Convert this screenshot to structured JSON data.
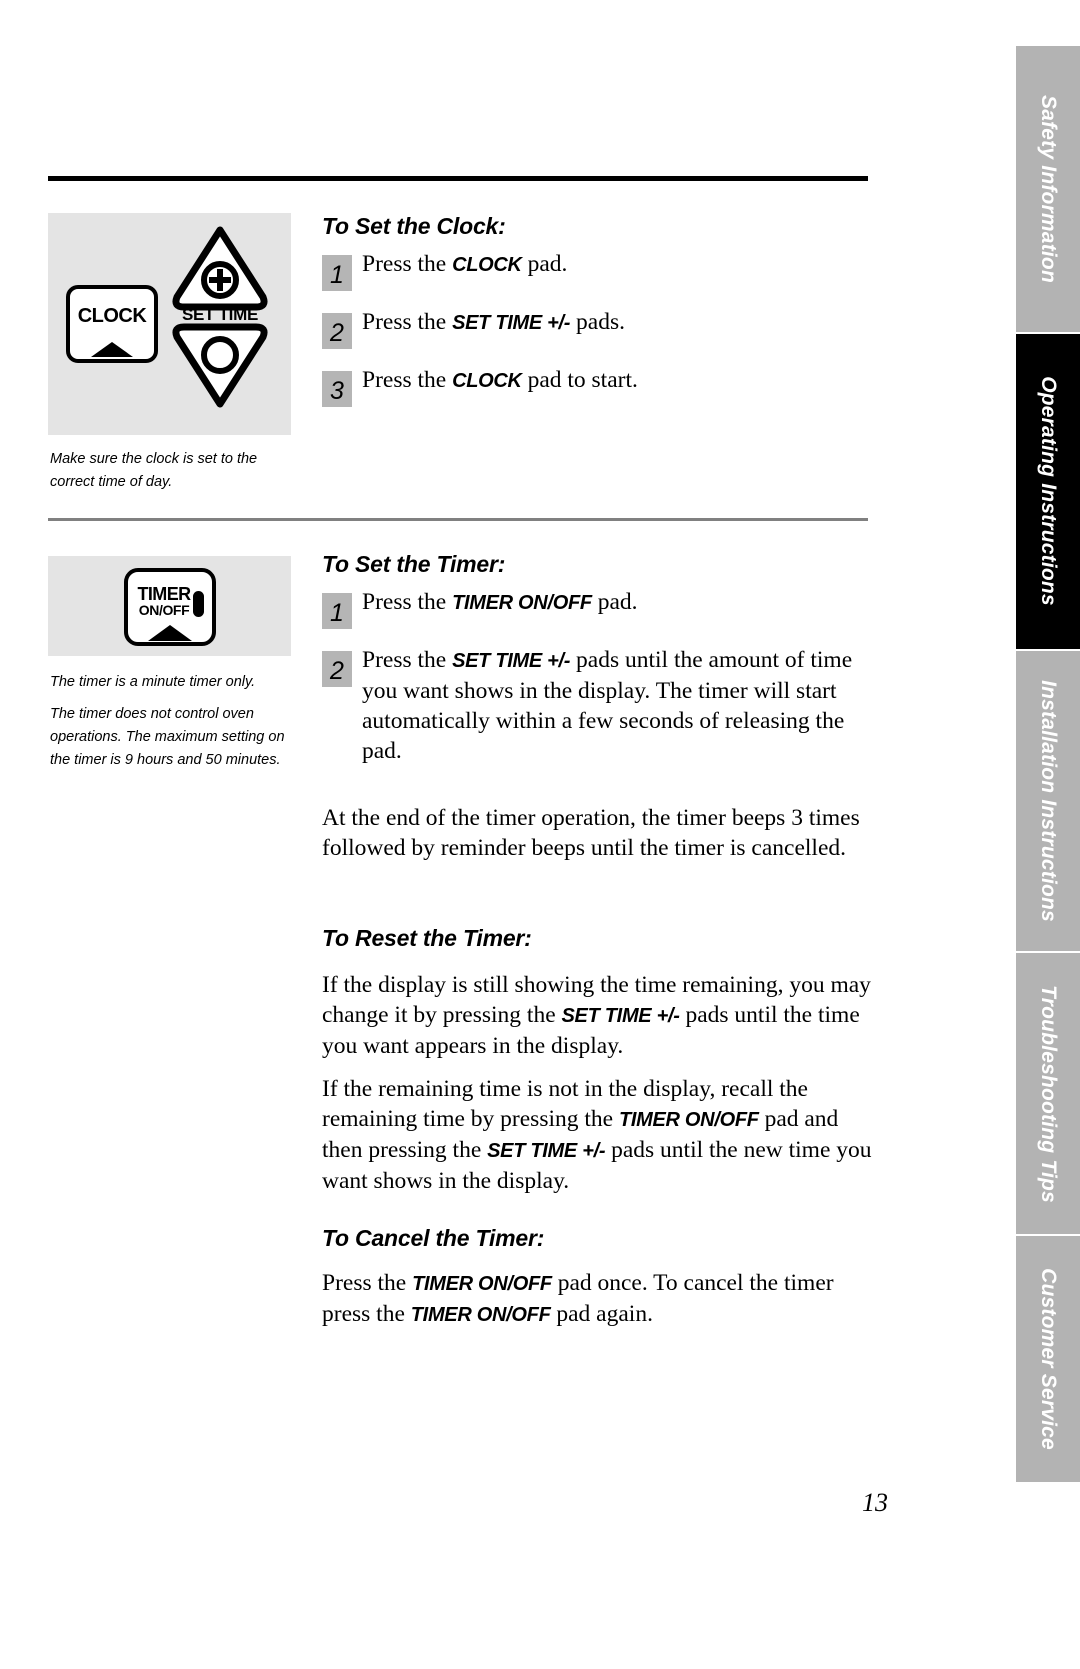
{
  "page": {
    "number": "13"
  },
  "sidebar": {
    "tabs": [
      {
        "label": "Safety Information",
        "active": false
      },
      {
        "label": "Operating Instructions",
        "active": true
      },
      {
        "label": "Installation Instructions",
        "active": false
      },
      {
        "label": "Troubleshooting Tips",
        "active": false
      },
      {
        "label": "Customer Service",
        "active": false
      }
    ]
  },
  "figures": {
    "clock": {
      "clock_pad_label": "CLOCK",
      "set_time_label": "SET TIME",
      "plus_symbol": "+",
      "minus_symbol": "-",
      "caption": "Make sure the clock is set to the correct time of day."
    },
    "timer": {
      "timer_pad_line1": "TIMER",
      "timer_pad_line2": "ON/OFF",
      "caption_1": "The timer is a minute timer only.",
      "caption_2": "The timer does not control oven operations. The maximum setting on the timer is 9 hours and 50 minutes."
    }
  },
  "sections": {
    "set_clock": {
      "heading": "To Set the Clock:",
      "steps": [
        {
          "num": "1",
          "pre": "Press the ",
          "bold": "CLOCK",
          "post": " pad."
        },
        {
          "num": "2",
          "pre": "Press the ",
          "bold": "SET TIME +/-",
          "post": " pads."
        },
        {
          "num": "3",
          "pre": "Press the ",
          "bold": "CLOCK",
          "post": " pad to start."
        }
      ]
    },
    "set_timer": {
      "heading": "To Set the Timer:",
      "steps": [
        {
          "num": "1",
          "pre": "Press the ",
          "bold": "TIMER ON/OFF",
          "post": " pad."
        },
        {
          "num": "2",
          "pre": "Press the ",
          "bold": "SET TIME +/-",
          "post": " pads until the amount of time you want shows in the display. The timer will start automatically within a few seconds of releasing the pad."
        }
      ],
      "end_paragraph": "At the end of the timer operation, the timer beeps 3 times followed by reminder beeps until the timer is cancelled."
    },
    "reset_timer": {
      "heading": "To Reset the Timer:",
      "para1_pre": "If the display is still showing the time remaining, you may change it by pressing the ",
      "para1_bold": "SET TIME +/-",
      "para1_post": " pads until the time you want appears in the display.",
      "para2_pre": "If the remaining time is not in the display, recall the remaining time by pressing the ",
      "para2_bold1": "TIMER ON/OFF",
      "para2_mid": " pad and then pressing the ",
      "para2_bold2": "SET TIME +/-",
      "para2_post": " pads until the new time you want shows in the display."
    },
    "cancel_timer": {
      "heading": "To Cancel the Timer:",
      "para_pre": "Press the ",
      "para_bold1": "TIMER ON/OFF",
      "para_mid": " pad once. To cancel the timer press the ",
      "para_bold2": "TIMER ON/OFF",
      "para_post": " pad again."
    }
  },
  "colors": {
    "tab_inactive": "#b3b3b3",
    "tab_active": "#000000",
    "figure_bg": "#e4e4e4",
    "step_badge": "#b5b5b5"
  }
}
